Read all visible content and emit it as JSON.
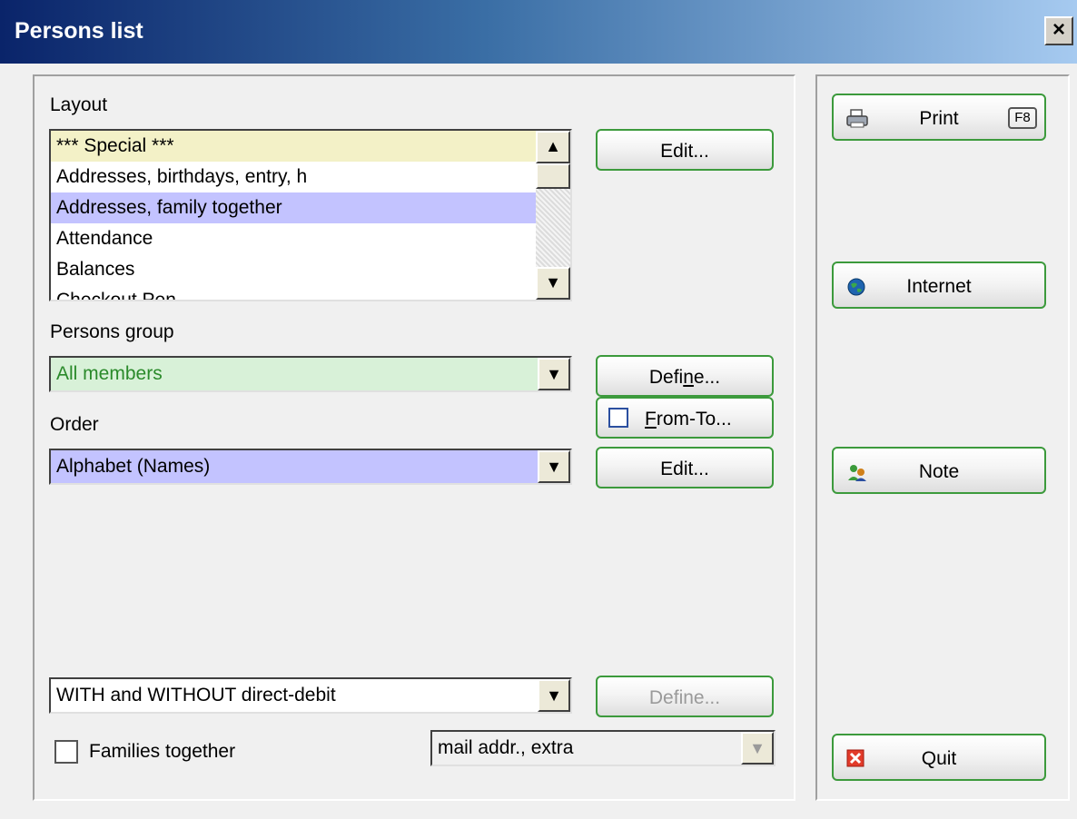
{
  "window": {
    "title": "Persons list",
    "close_label": "×"
  },
  "layout_section": {
    "label": "Layout",
    "items": [
      "*** Special ***",
      "Addresses, birthdays, entry, h",
      "Addresses, family together",
      "Attendance",
      "Balances",
      "Checkout Pen"
    ],
    "edit_label": "Edit..."
  },
  "persons_group": {
    "label_pre": "Persons ",
    "label_accel": "g",
    "label_post": "roup",
    "value": "All members",
    "define_pre": "Defi",
    "define_accel": "n",
    "define_post": "e...",
    "fromto_accel": "F",
    "fromto_post": "rom-To..."
  },
  "order": {
    "label": "Order",
    "value": "Alphabet (Names)",
    "edit_label": "Edit..."
  },
  "direct_debit": {
    "value": "WITH and WITHOUT direct-debit",
    "define_label": "Define..."
  },
  "families": {
    "label": "Families together",
    "checked": false,
    "mail_value": "mail addr., extra"
  },
  "side_buttons": {
    "print_label": "Print",
    "print_shortcut": "F8",
    "internet_label": "Internet",
    "note_label": "Note",
    "quit_label": "Quit"
  },
  "colors": {
    "title_start": "#0a246a",
    "title_end": "#a6caf0",
    "button_border": "#3c9a3c",
    "group_field_bg": "#d8f1d8",
    "group_field_text": "#2a8a2a",
    "order_field_bg": "#c3c3ff"
  },
  "icons": {
    "print": "printer-icon",
    "internet": "globe-icon",
    "note": "note-people-icon",
    "quit": "quit-x-icon",
    "arrow_up": "▲",
    "arrow_down": "▼"
  }
}
